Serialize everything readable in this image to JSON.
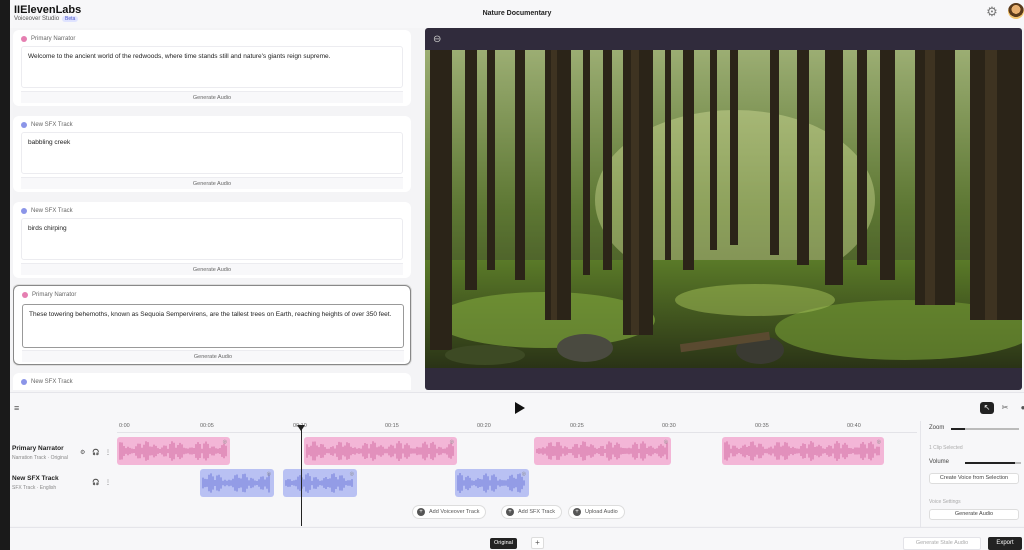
{
  "app": {
    "brand": "IIElevenLabs",
    "subtitle": "Voiceover Studio",
    "badge": "Beta",
    "project_title": "Nature Documentary"
  },
  "script_cards": [
    {
      "speaker": "Primary Narrator",
      "color": "#e57fb1",
      "text": "Welcome to the ancient world of the redwoods, where time stands still and nature's giants reign supreme.",
      "button": "Generate Audio",
      "active": false
    },
    {
      "speaker": "New SFX Track",
      "color": "#8b95e8",
      "text": "babbling creek",
      "button": "Generate Audio",
      "active": false
    },
    {
      "speaker": "New SFX Track",
      "color": "#8b95e8",
      "text": "birds chirping",
      "button": "Generate Audio",
      "active": false
    },
    {
      "speaker": "Primary Narrator",
      "color": "#e57fb1",
      "text": "These towering behemoths, known as Sequoia Sempervirens, are the tallest trees on Earth, reaching heights of over 350 feet.",
      "button": "Generate Audio",
      "active": true
    },
    {
      "speaker": "New SFX Track",
      "color": "#8b95e8",
      "text": "",
      "button": "",
      "active": false
    }
  ],
  "timeline": {
    "ticks": [
      "0:00",
      "00:05",
      "00:10",
      "00:15",
      "00:20",
      "00:25",
      "00:30",
      "00:35",
      "00:40"
    ],
    "tracks": [
      {
        "name": "Primary Narrator",
        "sub": "Narration Track · Original"
      },
      {
        "name": "New SFX Track",
        "sub": "SFX Track · English"
      }
    ],
    "add_buttons": [
      "Add Voiceover Track",
      "Add SFX Track",
      "Upload Audio"
    ]
  },
  "side_panel": {
    "zoom_label": "Zoom",
    "zoom_level": 0.2,
    "clip_selected": "1 Clip Selected",
    "volume_label": "Volume",
    "volume_level": 0.9,
    "create_voice": "Create Voice from Selection",
    "voice_settings": "Voice Settings",
    "generate_audio": "Generate Audio"
  },
  "bottom": {
    "tab_original": "Original",
    "add_tab": "+",
    "generate_stale": "Generate Stale Audio",
    "export": "Export"
  }
}
